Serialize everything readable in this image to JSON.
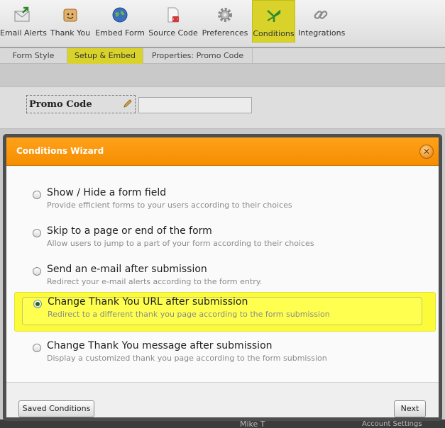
{
  "toolbar": {
    "items": [
      {
        "label": "Email Alerts",
        "icon": "envelope-icon"
      },
      {
        "label": "Thank You",
        "icon": "smiley-icon"
      },
      {
        "label": "Embed Form",
        "icon": "globe-icon"
      },
      {
        "label": "Source Code",
        "icon": "document-icon"
      },
      {
        "label": "Preferences",
        "icon": "gear-icon"
      },
      {
        "label": "Conditions",
        "icon": "conditions-icon"
      },
      {
        "label": "Integrations",
        "icon": "chain-link-icon"
      }
    ],
    "active": "Conditions"
  },
  "subtabs": {
    "items": [
      "Form Style",
      "Setup & Embed",
      "Properties: Promo Code"
    ],
    "active": "Setup & Embed"
  },
  "form": {
    "field_label": "Promo Code",
    "field_value": ""
  },
  "background_footer": {
    "user_text": "Mike T",
    "account_text": "Account Settings"
  },
  "wizard": {
    "title": "Conditions Wizard",
    "options": [
      {
        "title": "Show / Hide a form field",
        "desc": "Provide efficient forms to your users according to their choices",
        "selected": false
      },
      {
        "title": "Skip to a page or end of the form",
        "desc": "Allow users to jump to a part of your form according to their choices",
        "selected": false
      },
      {
        "title": "Send an e-mail after submission",
        "desc": "Redirect your e-mail alerts according to the form entry.",
        "selected": false
      },
      {
        "title": "Change Thank You URL after submission",
        "desc": "Redirect to a different thank you page according to the form submission",
        "selected": true
      },
      {
        "title": "Change Thank You message after submission",
        "desc": "Display a customized thank you page according to the form submission",
        "selected": false
      }
    ],
    "saved_conditions_label": "Saved Conditions",
    "next_label": "Next"
  },
  "colors": {
    "header_orange": "#f7930b",
    "highlight_yellow": "#fbfb3a",
    "active_tab": "#d8d22a"
  }
}
